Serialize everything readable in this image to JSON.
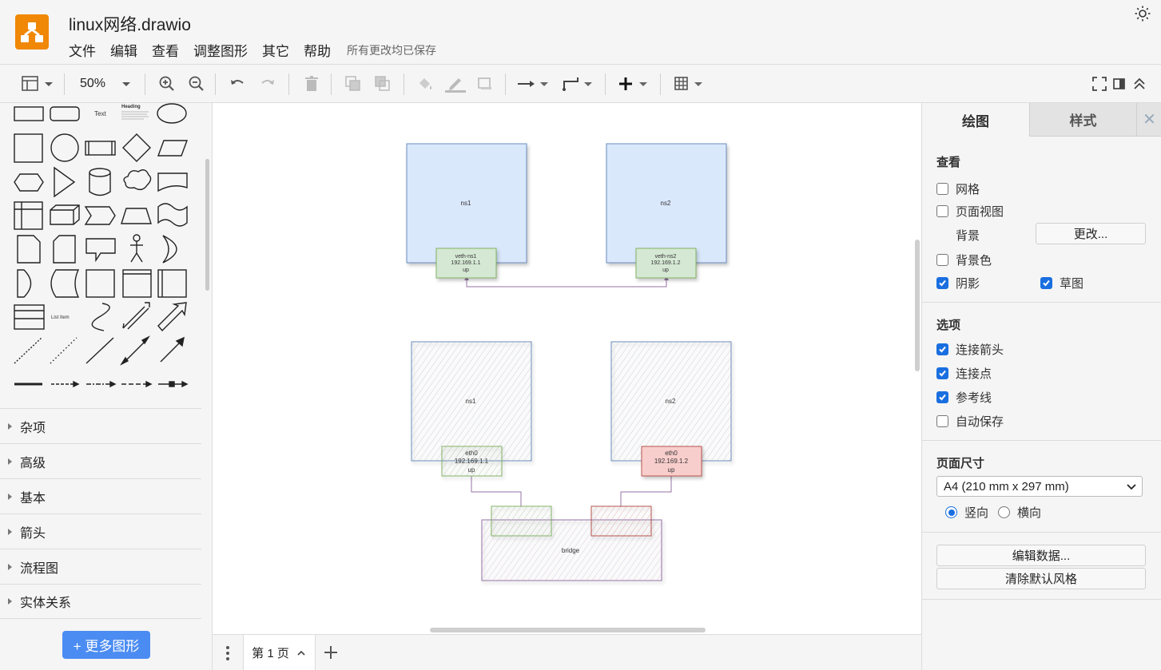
{
  "title": "linux网络.drawio",
  "menu": [
    "文件",
    "编辑",
    "查看",
    "调整图形",
    "其它",
    "帮助"
  ],
  "save_status": "所有更改均已保存",
  "toolbar": {
    "zoom": "50%"
  },
  "sidebar": {
    "palette_text": {
      "text": "Text",
      "heading": "Heading",
      "list_item": "List Item"
    },
    "categories": [
      "杂项",
      "高级",
      "基本",
      "箭头",
      "流程图",
      "实体关系"
    ],
    "more_shapes": "+ 更多图形"
  },
  "diagram": {
    "top": {
      "ns1": "ns1",
      "ns2": "ns2",
      "veth1": [
        "veth-ns1",
        "192.169.1.1",
        "up"
      ],
      "veth2": [
        "veth-ns2",
        "192.169.1.2",
        "up"
      ]
    },
    "bottom": {
      "ns1": "ns1",
      "ns2": "ns2",
      "eth1": [
        "eth0",
        "192.169.1.1",
        "up"
      ],
      "eth2": [
        "eth0",
        "192.169.1.2",
        "up"
      ],
      "bridge": "bridge"
    }
  },
  "pages": {
    "current": "第 1 页"
  },
  "panel": {
    "tabs": {
      "draw": "绘图",
      "style": "样式"
    },
    "view": {
      "title": "查看",
      "grid": {
        "label": "网格",
        "checked": false
      },
      "page_view": {
        "label": "页面视图",
        "checked": false
      },
      "background": {
        "label": "背景",
        "button": "更改..."
      },
      "background_color": {
        "label": "背景色",
        "checked": false
      },
      "shadow": {
        "label": "阴影",
        "checked": true
      },
      "sketch": {
        "label": "草图",
        "checked": true
      }
    },
    "options": {
      "title": "选项",
      "connection_arrows": {
        "label": "连接箭头",
        "checked": true
      },
      "connection_points": {
        "label": "连接点",
        "checked": true
      },
      "guides": {
        "label": "参考线",
        "checked": true
      },
      "autosave": {
        "label": "自动保存",
        "checked": false
      }
    },
    "page_size": {
      "title": "页面尺寸",
      "selected": "A4 (210 mm x 297 mm)",
      "portrait": "竖向",
      "landscape": "横向",
      "orientation": "portrait"
    },
    "edit_data": "编辑数据...",
    "clear_style": "清除默认风格"
  },
  "colors": {
    "accent": "#1a6fe0",
    "brand": "#f08705",
    "more_button": "#4b8cf3",
    "ns_fill": "#dae8fc",
    "ns_stroke": "#6c8ebf",
    "veth_fill": "#d5e8d4",
    "veth_stroke": "#82b366",
    "red_fill": "#f8cecc",
    "red_stroke": "#b85450",
    "bridge_stroke": "#9673a6"
  }
}
